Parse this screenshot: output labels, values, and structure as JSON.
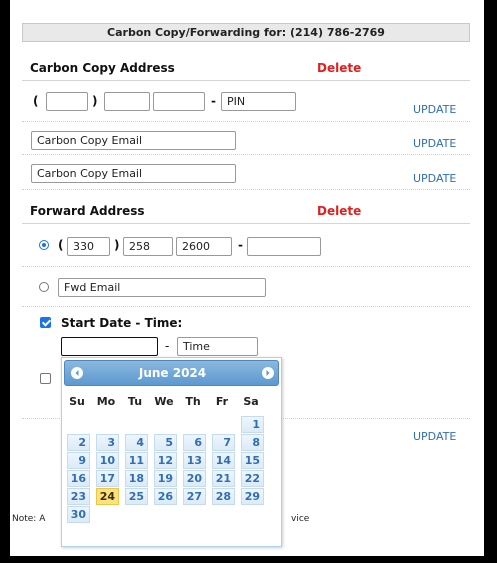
{
  "header": {
    "title": "Carbon Copy/Forwarding for: (214) 786-2769"
  },
  "carbon_copy": {
    "section_title": "Carbon Copy Address",
    "delete_label": "Delete",
    "phone": {
      "open_paren": "(",
      "close_paren": ")",
      "dash": "-",
      "area": "",
      "prefix": "",
      "line": "",
      "pin_placeholder": "PIN"
    },
    "emails": [
      "Carbon Copy Email",
      "Carbon Copy Email"
    ],
    "update_label": "UPDATE"
  },
  "forward": {
    "section_title": "Forward Address",
    "delete_label": "Delete",
    "phone": {
      "open_paren": "(",
      "close_paren": ")",
      "dash": "-",
      "area": "330",
      "prefix": "258",
      "line": "2600",
      "pin": ""
    },
    "email_placeholder": "Fwd Email",
    "start_label": "Start Date - Time:",
    "date_value": "",
    "time_placeholder": "Time",
    "update_label": "UPDATE"
  },
  "note": {
    "prefix": "Note: A",
    "suffix": "vice"
  },
  "datepicker": {
    "title": "June 2024",
    "dow": [
      "Su",
      "Mo",
      "Tu",
      "We",
      "Th",
      "Fr",
      "Sa"
    ],
    "days": [
      "1",
      "2",
      "3",
      "4",
      "5",
      "6",
      "7",
      "8",
      "9",
      "10",
      "11",
      "12",
      "13",
      "14",
      "15",
      "16",
      "17",
      "18",
      "19",
      "20",
      "21",
      "22",
      "23",
      "24",
      "25",
      "26",
      "27",
      "28",
      "29",
      "30"
    ],
    "first_weekday": 6,
    "today": 24
  },
  "colors": {
    "accent": "#1a73e8",
    "delete": "#e02020",
    "link": "#2f6fb5",
    "today": "#fbe27a"
  }
}
